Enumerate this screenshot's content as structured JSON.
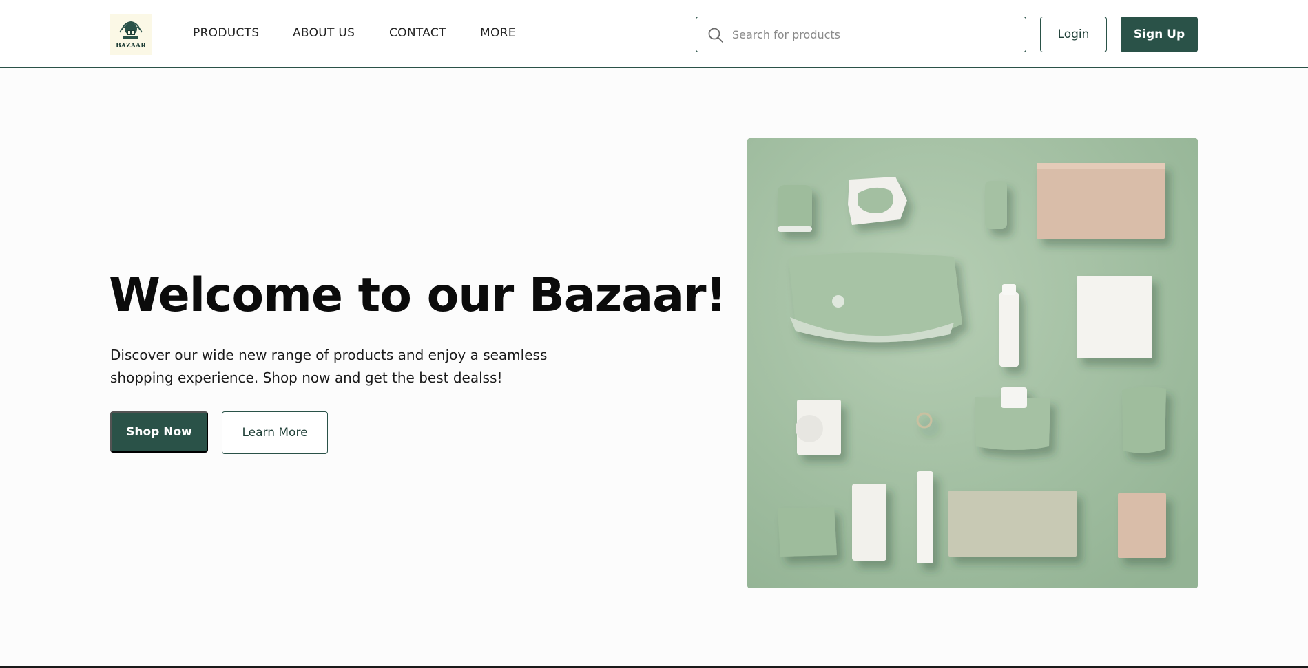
{
  "header": {
    "logo": {
      "text": "BAZAAR",
      "icon": "bazaar-logo"
    },
    "nav": [
      {
        "label": "PRODUCTS"
      },
      {
        "label": "ABOUT US"
      },
      {
        "label": "CONTACT"
      },
      {
        "label": "MORE"
      }
    ],
    "search": {
      "placeholder": "Search for products",
      "value": "",
      "icon": "search-icon"
    },
    "login_label": "Login",
    "signup_label": "Sign Up"
  },
  "hero": {
    "title": "Welcome to our Bazaar!",
    "description": "Discover our wide new range of products and enjoy a seamless shopping experience. Shop now and get the best dealss!",
    "shop_now_label": "Shop Now",
    "learn_more_label": "Learn More",
    "image": "product-flatlay-image"
  },
  "colors": {
    "brand": "#2a5248",
    "background": "#fcfcfc",
    "image_background": "#a8c4a8",
    "logo_background": "#fbf8e6"
  }
}
